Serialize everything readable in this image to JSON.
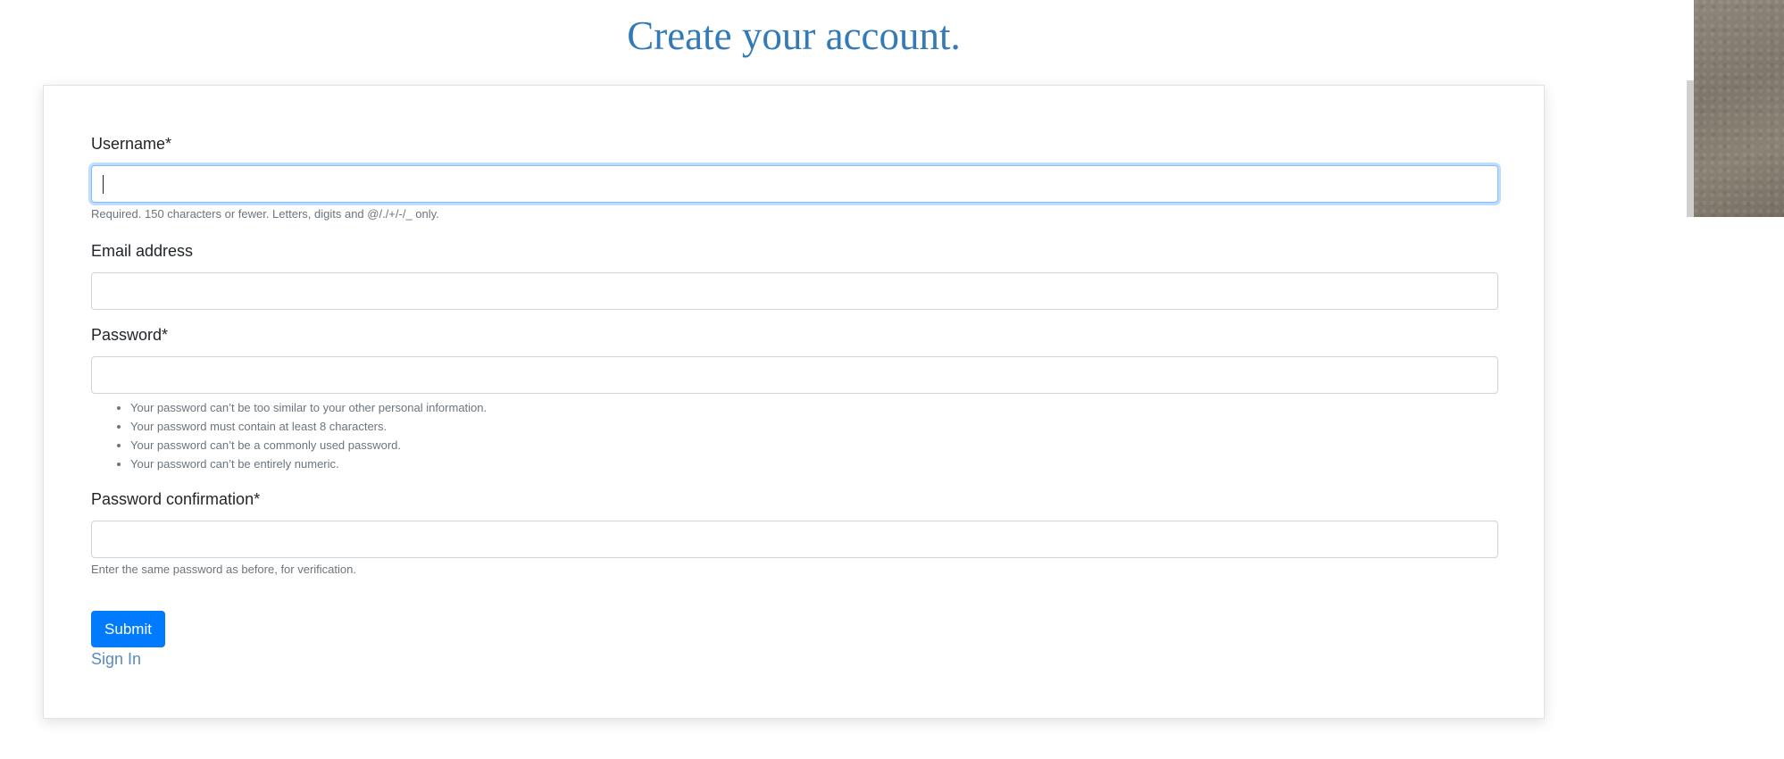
{
  "page": {
    "title": "Create your account."
  },
  "form": {
    "username": {
      "label": "Username*",
      "value": "",
      "help": "Required. 150 characters or fewer. Letters, digits and @/./+/-/_ only."
    },
    "email": {
      "label": "Email address",
      "value": ""
    },
    "password": {
      "label": "Password*",
      "value": "",
      "rules": [
        "Your password can’t be too similar to your other personal information.",
        "Your password must contain at least 8 characters.",
        "Your password can’t be a commonly used password.",
        "Your password can’t be entirely numeric."
      ]
    },
    "password_confirmation": {
      "label": "Password confirmation*",
      "value": "",
      "help": "Enter the same password as before, for verification."
    },
    "submit_label": "Submit",
    "signin_label": "Sign In"
  },
  "colors": {
    "title": "#337ab7",
    "primary": "#007bff",
    "link": "#5a8bbf"
  }
}
